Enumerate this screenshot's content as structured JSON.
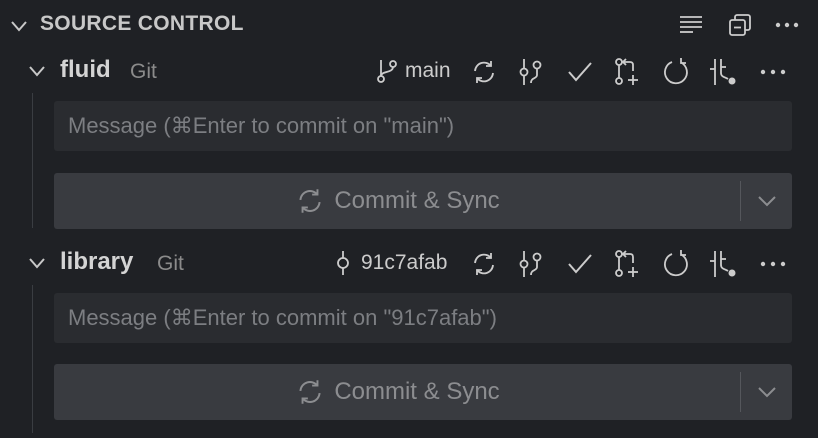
{
  "panel": {
    "title": "SOURCE CONTROL"
  },
  "icons": {
    "chevron": "chevron-down-icon",
    "header": [
      "list-view-icon",
      "collapse-all-icon",
      "more-actions-icon"
    ],
    "repo_actions": [
      "sync-icon",
      "graph-icon",
      "check-icon",
      "create-pull-request-icon",
      "refresh-icon",
      "branch-actions-icon",
      "more-actions-icon"
    ]
  },
  "repos": [
    {
      "name": "fluid",
      "provider": "Git",
      "ref_label": "main",
      "ref_icon": "git-branch-icon",
      "message_value": "",
      "message_placeholder": "Message (⌘Enter to commit on \"main\")",
      "commit_label": "Commit & Sync"
    },
    {
      "name": "library",
      "provider": "Git",
      "ref_label": "91c7afab",
      "ref_icon": "git-commit-icon",
      "message_value": "",
      "message_placeholder": "Message (⌘Enter to commit on \"91c7afab\")",
      "commit_label": "Commit & Sync"
    }
  ],
  "colors": {
    "background": "#1f2125",
    "input_background": "#2a2c30",
    "button_background": "#393b40",
    "button_text": "#8c8d90",
    "icon": "#cccccc",
    "placeholder": "#7c7e82"
  }
}
